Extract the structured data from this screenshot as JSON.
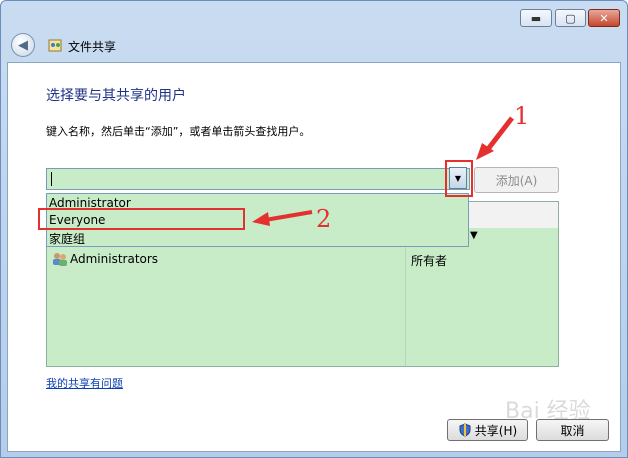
{
  "window": {
    "title": "文件共享",
    "controls": {
      "minimize": "▬",
      "maximize": "▢",
      "close": "✕"
    }
  },
  "heading": "选择要与其共享的用户",
  "instruction": "键入名称，然后单击“添加”，或者单击箭头查找用户。",
  "combo": {
    "value": "",
    "dropdown_arrow": "▼"
  },
  "add_button": "添加(A)",
  "dropdown_options": [
    "Administrator",
    "Everyone",
    "家庭组"
  ],
  "table": {
    "rows": [
      {
        "name": "Administrators",
        "permission": "所有者"
      }
    ]
  },
  "help_link": "我的共享有问题",
  "share_button": "共享(H)",
  "cancel_button": "取消",
  "annotations": {
    "label_1": "1",
    "label_2": "2"
  },
  "accent_colors": {
    "annotation_red": "#e53030",
    "heading_blue": "#1e3287",
    "selection_green": "#c8ebc8"
  },
  "watermark": "Bai 经验"
}
